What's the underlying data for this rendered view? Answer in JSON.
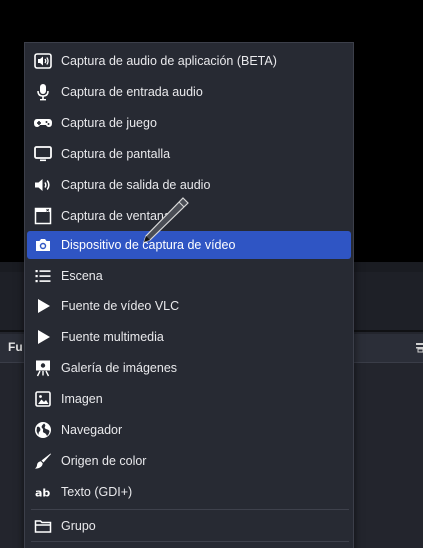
{
  "sources_dock": {
    "title": "Fu"
  },
  "add_source_menu": {
    "items": [
      {
        "label": "Captura de audio de aplicación (BETA)",
        "icon": "app-audio-icon"
      },
      {
        "label": "Captura de entrada audio",
        "icon": "microphone-icon"
      },
      {
        "label": "Captura de juego",
        "icon": "gamepad-icon"
      },
      {
        "label": "Captura de pantalla",
        "icon": "monitor-icon"
      },
      {
        "label": "Captura de salida de audio",
        "icon": "speaker-icon"
      },
      {
        "label": "Captura de ventana",
        "icon": "window-icon"
      },
      {
        "label": "Dispositivo de captura de vídeo",
        "icon": "camera-icon"
      },
      {
        "label": "Escena",
        "icon": "list-icon"
      },
      {
        "label": "Fuente de vídeo VLC",
        "icon": "play-icon"
      },
      {
        "label": "Fuente multimedia",
        "icon": "play-icon"
      },
      {
        "label": "Galería de imágenes",
        "icon": "slideshow-icon"
      },
      {
        "label": "Imagen",
        "icon": "image-icon"
      },
      {
        "label": "Navegador",
        "icon": "globe-icon"
      },
      {
        "label": "Origen de color",
        "icon": "brush-icon"
      },
      {
        "label": "Texto (GDI+)",
        "icon": "text-icon"
      },
      {
        "label": "Grupo",
        "icon": "folder-icon"
      }
    ],
    "highlighted_index": 6,
    "accent_color": "#2f55c4"
  }
}
